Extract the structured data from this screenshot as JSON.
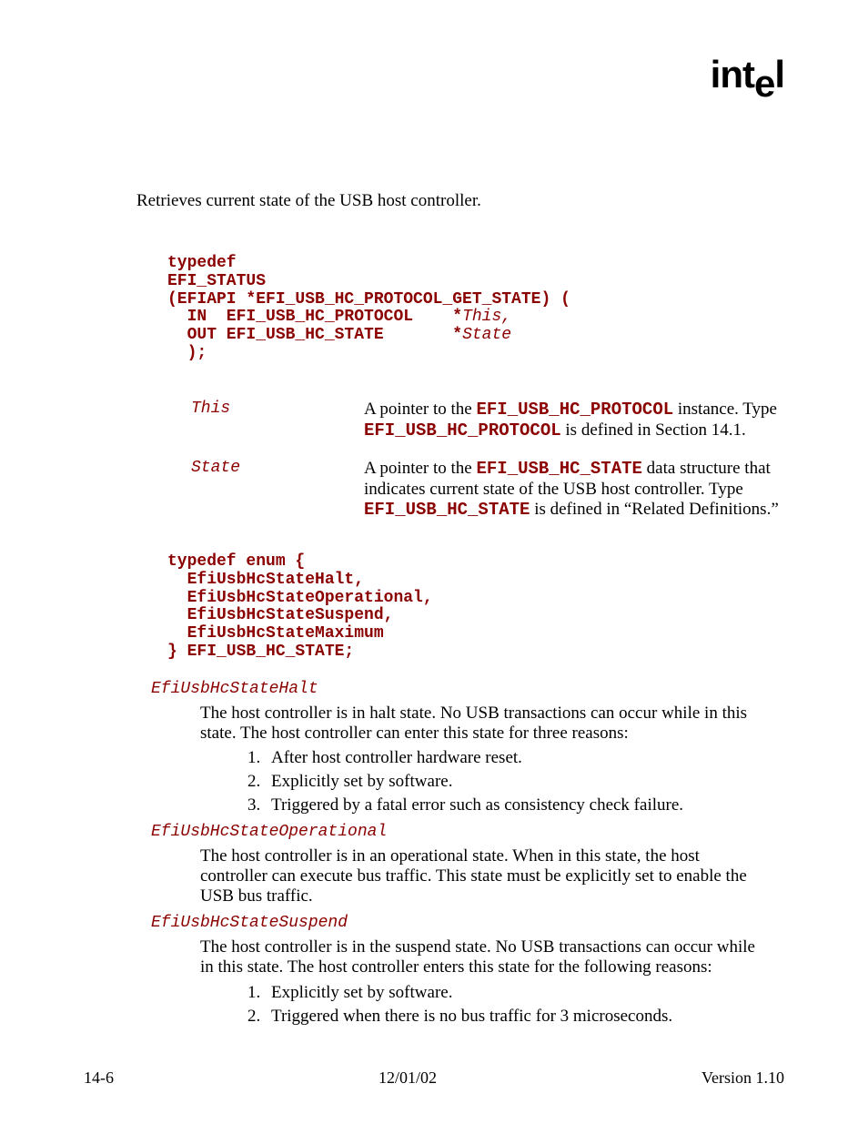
{
  "logo_text": "intel",
  "intro": "Retrieves current state of the USB host controller.",
  "code_block": "typedef\nEFI_STATUS\n(EFIAPI *EFI_USB_HC_PROTOCOL_GET_STATE) (\n  IN  EFI_USB_HC_PROTOCOL    *",
  "code_param1": "This,",
  "code_mid": "\n  OUT EFI_USB_HC_STATE       *",
  "code_param2": "State",
  "code_end": "\n  );",
  "params": [
    {
      "name": "This",
      "desc_pre": "A pointer to the ",
      "desc_code1": "EFI_USB_HC_PROTOCOL",
      "desc_mid": " instance.  Type ",
      "desc_code2": "EFI_USB_HC_PROTOCOL",
      "desc_post": " is defined in Section 14.1."
    },
    {
      "name": "State",
      "desc_pre": "A pointer to the ",
      "desc_code1": "EFI_USB_HC_STATE",
      "desc_mid": " data structure that indicates current state of the USB host controller.  Type ",
      "desc_code2": "EFI_USB_HC_STATE",
      "desc_post": " is defined in “Related Definitions.”"
    }
  ],
  "enum_block": "typedef enum {\n  EfiUsbHcStateHalt,\n  EfiUsbHcStateOperational,\n  EfiUsbHcStateSuspend,\n  EfiUsbHcStateMaximum\n} EFI_USB_HC_STATE;",
  "enums": [
    {
      "name": "EfiUsbHcStateHalt",
      "desc": "The host controller is in halt state.  No USB transactions can occur while in this state.  The host controller can enter this state for three reasons:",
      "items": [
        "After host controller hardware reset.",
        "Explicitly set by software.",
        "Triggered by a fatal error such as consistency check failure."
      ]
    },
    {
      "name": "EfiUsbHcStateOperational",
      "desc": "The host controller is in an operational state.  When in this state, the host controller can execute bus traffic.  This state must be explicitly set to enable the USB bus traffic.",
      "items": []
    },
    {
      "name": "EfiUsbHcStateSuspend",
      "desc": "The host controller is in the suspend state.  No USB transactions can occur while in this state.  The host controller enters this state for the following reasons:",
      "items": [
        "Explicitly set by software.",
        "Triggered when there is no bus traffic for 3 microseconds."
      ]
    }
  ],
  "footer": {
    "left": "14-6",
    "center": "12/01/02",
    "right": "Version 1.10"
  }
}
